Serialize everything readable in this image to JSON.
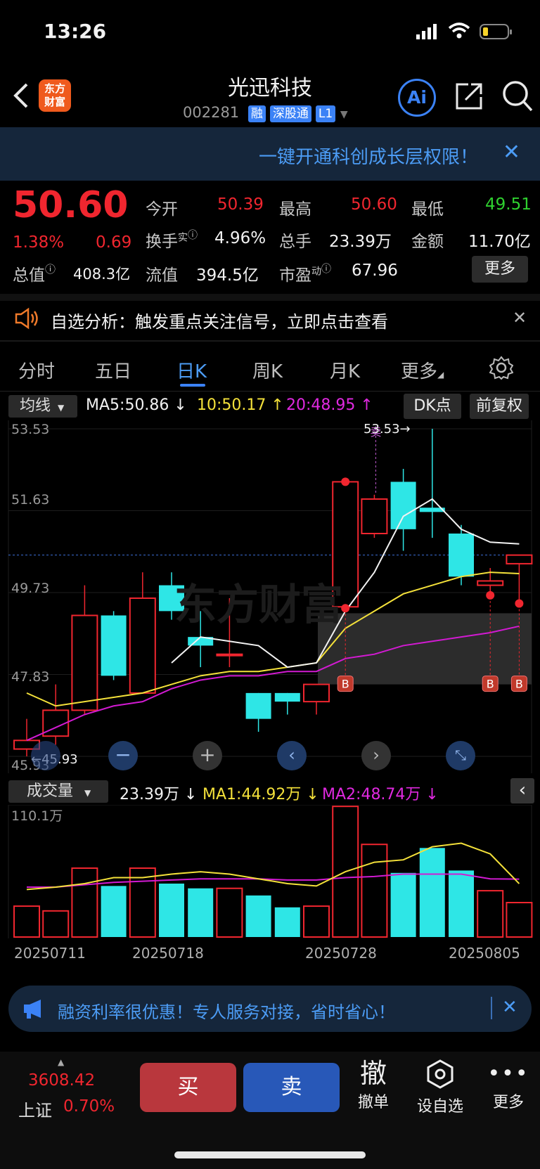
{
  "status_bar": {
    "time": "13:26"
  },
  "header": {
    "title": "光迅科技",
    "code": "002281",
    "tags": [
      "融",
      "深股通",
      "L1"
    ],
    "logo_text": "东方财富",
    "ai_label": "Ai"
  },
  "promo_top": {
    "text": "一键开通科创成长层权限！"
  },
  "quote": {
    "price": "50.60",
    "change_pct": "1.38%",
    "change": "0.69",
    "open_label": "今开",
    "open": "50.39",
    "high_label": "最高",
    "high": "50.60",
    "low_label": "最低",
    "low": "49.51",
    "turnover_label": "换手",
    "turnover_sup": "实",
    "turnover": "4.96%",
    "volume_label": "总手",
    "volume": "23.39万",
    "amount_label": "金额",
    "amount": "11.70亿",
    "mktcap_label": "总值",
    "mktcap": "408.3亿",
    "float_label": "流值",
    "float": "394.5亿",
    "pe_label": "市盈",
    "pe_sup": "动",
    "pe": "67.96",
    "more": "更多"
  },
  "alert": {
    "text": "自选分析：触发重点关注信号，立即点击查看"
  },
  "tabs": [
    "分时",
    "五日",
    "日K",
    "周K",
    "月K",
    "更多"
  ],
  "active_tab": "日K",
  "ma_bar": {
    "selector": "均线",
    "ma5": "MA5:50.86",
    "ma10": "10:50.17",
    "ma20": "20:48.95",
    "dk": "DK点",
    "fq": "前复权"
  },
  "price_axis": [
    "53.53",
    "51.63",
    "49.73",
    "47.83",
    "45.93"
  ],
  "annotations": {
    "high": "53.53→",
    "low": "←45.93",
    "b": "B",
    "s": "卖"
  },
  "volume_bar": {
    "selector": "成交量",
    "vol": "23.39万",
    "ma1": "MA1:44.92万",
    "ma2": "MA2:48.74万",
    "max": "110.1万"
  },
  "dates": [
    "20250711",
    "20250718",
    "20250728",
    "20250805"
  ],
  "promo_bottom": {
    "text": "融资利率很优惠！专人服务对接，省时省心！"
  },
  "bottom": {
    "index_value": "3608.42",
    "index_name": "上证",
    "index_pct": "0.70%",
    "buy": "买",
    "sell": "卖",
    "cancel_icon": "撤",
    "cancel": "撤单",
    "watch": "设自选",
    "more": "更多"
  },
  "colors": {
    "up": "#f0262f",
    "down": "#2ee6e6",
    "ma5": "#f2f2f2",
    "ma10": "#f4e13a",
    "ma20": "#d21ad2"
  },
  "chart_data": {
    "type": "candlestick",
    "price_range": [
      45.93,
      53.53
    ],
    "candles": [
      {
        "o": 46.1,
        "c": 46.3,
        "h": 46.8,
        "l": 45.93
      },
      {
        "o": 46.4,
        "c": 47.0,
        "h": 47.6,
        "l": 46.2
      },
      {
        "o": 47.0,
        "c": 49.2,
        "h": 49.9,
        "l": 46.9
      },
      {
        "o": 49.2,
        "c": 47.8,
        "h": 49.3,
        "l": 47.7
      },
      {
        "o": 47.4,
        "c": 49.6,
        "h": 50.2,
        "l": 47.4
      },
      {
        "o": 49.9,
        "c": 49.3,
        "h": 50.2,
        "l": 49.1
      },
      {
        "o": 48.7,
        "c": 48.5,
        "h": 49.3,
        "l": 48.0
      },
      {
        "o": 48.3,
        "c": 48.3,
        "h": 49.6,
        "l": 48.0
      },
      {
        "o": 47.4,
        "c": 46.8,
        "h": 47.4,
        "l": 46.5
      },
      {
        "o": 47.4,
        "c": 47.2,
        "h": 47.4,
        "l": 46.9
      },
      {
        "o": 47.2,
        "c": 47.6,
        "h": 47.6,
        "l": 46.9
      },
      {
        "o": 49.4,
        "c": 52.3,
        "h": 52.3,
        "l": 49.4
      },
      {
        "o": 51.1,
        "c": 51.9,
        "h": 52.0,
        "l": 51.0
      },
      {
        "o": 52.3,
        "c": 51.2,
        "h": 52.6,
        "l": 50.7
      },
      {
        "o": 51.7,
        "c": 51.6,
        "h": 53.53,
        "l": 51.0
      },
      {
        "o": 51.1,
        "c": 50.1,
        "h": 51.3,
        "l": 49.9
      },
      {
        "o": 49.9,
        "c": 50.0,
        "h": 50.3,
        "l": 49.7
      },
      {
        "o": 50.4,
        "c": 50.6,
        "h": 50.6,
        "l": 49.51
      }
    ],
    "ma5": [
      null,
      null,
      null,
      null,
      null,
      48.1,
      48.7,
      48.6,
      48.5,
      48.0,
      48.1,
      49.3,
      50.2,
      51.5,
      51.9,
      51.2,
      50.9,
      50.86
    ],
    "ma10": [
      47.4,
      47.1,
      47.2,
      47.3,
      47.4,
      47.6,
      47.8,
      47.9,
      47.9,
      48.0,
      48.1,
      48.9,
      49.3,
      49.7,
      49.9,
      50.1,
      50.2,
      50.17
    ],
    "ma20": [
      46.3,
      46.6,
      46.9,
      47.1,
      47.2,
      47.5,
      47.7,
      47.8,
      47.8,
      47.9,
      47.9,
      48.2,
      48.3,
      48.5,
      48.6,
      48.7,
      48.8,
      48.95
    ],
    "volumes": [
      26,
      22,
      58,
      43,
      58,
      45,
      41,
      41,
      35,
      25,
      26,
      110,
      78,
      54,
      75,
      56,
      39,
      29
    ],
    "vol_ma1": [
      40,
      42,
      45,
      50,
      50,
      53,
      55,
      53,
      49,
      45,
      43,
      55,
      63,
      65,
      76,
      79,
      70,
      44.92
    ],
    "vol_ma2": [
      42,
      42,
      44,
      46,
      47,
      48,
      49,
      49,
      49,
      48,
      48,
      50,
      51,
      53,
      53,
      53,
      49,
      48.74
    ],
    "vol_max": 110.1,
    "b_marks": [
      11,
      16,
      17
    ]
  }
}
